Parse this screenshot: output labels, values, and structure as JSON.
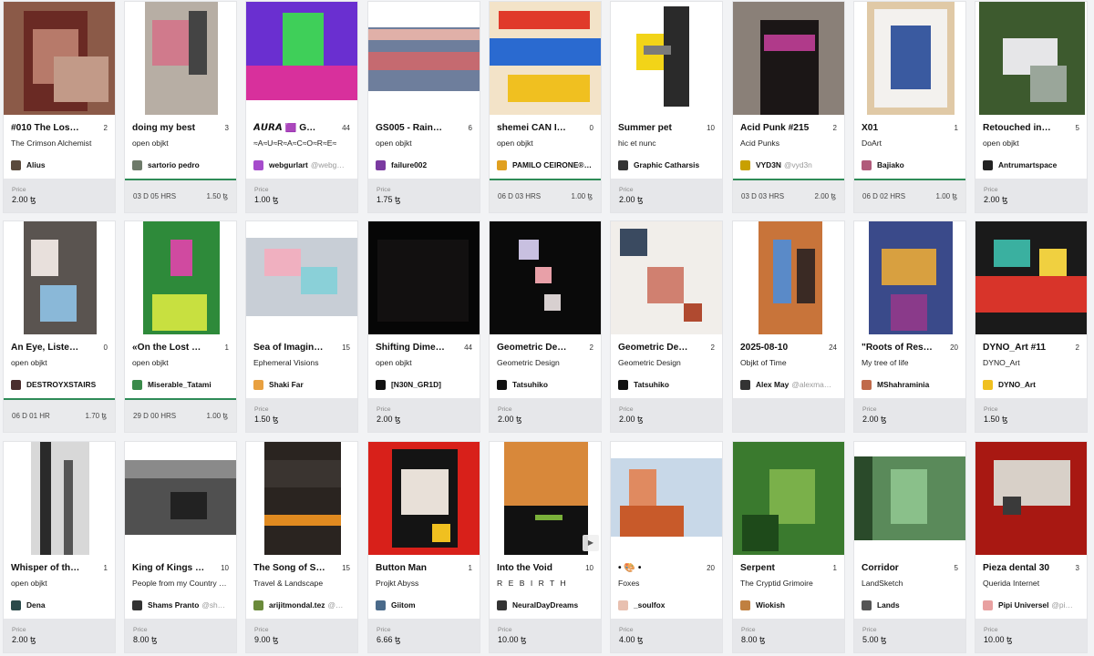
{
  "currency_symbol": "ꜩ",
  "price_label": "Price",
  "cards": [
    {
      "title": "#010 The Los…",
      "editions": "2",
      "collection": "The Crimson Alchemist",
      "artist": "Alius",
      "handle": "",
      "price": "2.00",
      "auction": false,
      "avatar_color": "#5a4a3c",
      "thumb_bg": "#8b5a48",
      "art": [
        {
          "c": "#6a2a24",
          "l": 22,
          "t": 10,
          "w": 70,
          "h": 110
        },
        {
          "c": "#b77a6a",
          "l": 32,
          "t": 30,
          "w": 50,
          "h": 60
        },
        {
          "c": "#c29a88",
          "l": 55,
          "t": 60,
          "w": 60,
          "h": 50
        }
      ]
    },
    {
      "title": "doing my best",
      "editions": "3",
      "collection": "open objkt",
      "artist": "sartorio pedro",
      "handle": "",
      "auction": true,
      "time": "03 D  05 HRS",
      "auc_price": "1.50",
      "avatar_color": "#6e7a6a",
      "thumb_bg": "#ffffff",
      "art": [
        {
          "c": "#b7aea4",
          "l": 22,
          "t": 0,
          "w": 80,
          "h": 124
        },
        {
          "c": "#d07a8c",
          "l": 30,
          "t": 20,
          "w": 40,
          "h": 50
        },
        {
          "c": "#444444",
          "l": 70,
          "t": 10,
          "w": 20,
          "h": 70
        }
      ]
    },
    {
      "title": "𝘼𝙐𝙍𝘼 🟪 G…",
      "editions": "44",
      "collection": "≈A≈U≈R≈A≈C≈O≈R≈E≈",
      "artist": "webgurlart",
      "handle": "@webg…",
      "price": "1.00",
      "auction": false,
      "avatar_color": "#a64ccc",
      "thumb_bg": "#ffffff",
      "art": [
        {
          "c": "#6a2fd0",
          "l": 0,
          "t": 0,
          "w": 124,
          "h": 108
        },
        {
          "c": "#3fcf59",
          "l": 40,
          "t": 12,
          "w": 45,
          "h": 70
        },
        {
          "c": "#d8309c",
          "l": 0,
          "t": 70,
          "w": 124,
          "h": 38
        }
      ]
    },
    {
      "title": "GS005 - Rain…",
      "editions": "6",
      "collection": "open objkt",
      "artist": "failure002",
      "handle": "",
      "price": "1.75",
      "auction": false,
      "avatar_color": "#7a3aa0",
      "thumb_bg": "#ffffff",
      "art": [
        {
          "c": "#6e7e9c",
          "l": 0,
          "t": 28,
          "w": 124,
          "h": 70
        },
        {
          "c": "#c56a70",
          "l": 0,
          "t": 55,
          "w": 124,
          "h": 20
        },
        {
          "c": "#e0b0a8",
          "l": 0,
          "t": 30,
          "w": 124,
          "h": 12
        }
      ]
    },
    {
      "title": "shemei CAN I…",
      "editions": "0",
      "collection": "open objkt",
      "artist": "PAMILO CEIRONE®…",
      "handle": "",
      "auction": true,
      "time": "06 D  03 HRS",
      "auc_price": "1.00",
      "avatar_color": "#e0a020",
      "thumb_bg": "#f3e3c8",
      "art": [
        {
          "c": "#e03a2a",
          "l": 10,
          "t": 10,
          "w": 100,
          "h": 20
        },
        {
          "c": "#2a6ad0",
          "l": 0,
          "t": 40,
          "w": 124,
          "h": 30
        },
        {
          "c": "#f0c020",
          "l": 20,
          "t": 80,
          "w": 90,
          "h": 30
        }
      ]
    },
    {
      "title": "Summer pet",
      "editions": "10",
      "collection": "hic et nunc",
      "artist": "Graphic Catharsis",
      "handle": "",
      "price": "2.00",
      "auction": false,
      "avatar_color": "#333333",
      "thumb_bg": "#ffffff",
      "art": [
        {
          "c": "#f2d418",
          "l": 28,
          "t": 35,
          "w": 40,
          "h": 40
        },
        {
          "c": "#2a2a2a",
          "l": 58,
          "t": 5,
          "w": 28,
          "h": 110
        },
        {
          "c": "#7a7a7a",
          "l": 36,
          "t": 48,
          "w": 30,
          "h": 10
        }
      ]
    },
    {
      "title": "Acid Punk #215",
      "editions": "2",
      "collection": "Acid Punks",
      "artist": "VYD3N",
      "handle": "@vyd3n",
      "auction": true,
      "time": "03 D  03 HRS",
      "auc_price": "2.00",
      "avatar_color": "#c8a000",
      "thumb_bg": "#2e2522",
      "art": [
        {
          "c": "#8a8078",
          "l": 0,
          "t": 0,
          "w": 124,
          "h": 124
        },
        {
          "c": "#1b1616",
          "l": 30,
          "t": 20,
          "w": 64,
          "h": 104
        },
        {
          "c": "#b03a8a",
          "l": 34,
          "t": 36,
          "w": 56,
          "h": 18
        }
      ]
    },
    {
      "title": "X01",
      "editions": "1",
      "collection": "DoArt",
      "artist": "Bajiako",
      "handle": "",
      "auction": true,
      "time": "06 D  02 HRS",
      "auc_price": "1.00",
      "avatar_color": "#b05a7a",
      "thumb_bg": "#ffffff",
      "art": [
        {
          "c": "#e0c9a6",
          "l": 14,
          "t": 0,
          "w": 96,
          "h": 124
        },
        {
          "c": "#f3f1ee",
          "l": 22,
          "t": 8,
          "w": 80,
          "h": 108
        },
        {
          "c": "#3a5aa0",
          "l": 40,
          "t": 26,
          "w": 44,
          "h": 70
        }
      ]
    },
    {
      "title": "Retouched in…",
      "editions": "5",
      "collection": "open objkt",
      "artist": "Antrumartspace",
      "handle": "",
      "price": "2.00",
      "auction": false,
      "avatar_color": "#222222",
      "thumb_bg": "#ffffff",
      "art": [
        {
          "c": "#3d5a2e",
          "l": 4,
          "t": 0,
          "w": 116,
          "h": 124
        },
        {
          "c": "#e6e6e8",
          "l": 30,
          "t": 40,
          "w": 60,
          "h": 40
        },
        {
          "c": "#9aa69a",
          "l": 60,
          "t": 70,
          "w": 40,
          "h": 40
        }
      ]
    },
    {
      "title": "An Eye, Liste…",
      "editions": "0",
      "collection": "open objkt",
      "artist": "DESTROYXSTAIRS",
      "handle": "",
      "auction": true,
      "time": "06 D  01 HR",
      "auc_price": "1.70",
      "avatar_color": "#4a2e2e",
      "thumb_bg": "#ffffff",
      "art": [
        {
          "c": "#5a5450",
          "l": 22,
          "t": 0,
          "w": 80,
          "h": 124
        },
        {
          "c": "#8ab8d8",
          "l": 40,
          "t": 70,
          "w": 40,
          "h": 40
        },
        {
          "c": "#e8e0dc",
          "l": 30,
          "t": 20,
          "w": 30,
          "h": 40
        }
      ]
    },
    {
      "title": "«On the Lost …",
      "editions": "1",
      "collection": "open objkt",
      "artist": "Miserable_Tatami",
      "handle": "",
      "auction": true,
      "time": "29 D  00 HRS",
      "auc_price": "1.00",
      "avatar_color": "#3a8a4a",
      "thumb_bg": "#ffffff",
      "art": [
        {
          "c": "#2e8a3a",
          "l": 20,
          "t": 0,
          "w": 84,
          "h": 124
        },
        {
          "c": "#d04aa0",
          "l": 50,
          "t": 20,
          "w": 24,
          "h": 40
        },
        {
          "c": "#c8e040",
          "l": 30,
          "t": 80,
          "w": 60,
          "h": 40
        }
      ]
    },
    {
      "title": "Sea of Imagin…",
      "editions": "15",
      "collection": "Ephemeral Visions",
      "artist": "Shaki Far",
      "handle": "",
      "price": "1.50",
      "auction": false,
      "avatar_color": "#e8a040",
      "thumb_bg": "#ffffff",
      "art": [
        {
          "c": "#c8ced6",
          "l": 0,
          "t": 18,
          "w": 124,
          "h": 86
        },
        {
          "c": "#f0b0c0",
          "l": 20,
          "t": 30,
          "w": 40,
          "h": 30
        },
        {
          "c": "#8ad0d8",
          "l": 60,
          "t": 50,
          "w": 40,
          "h": 30
        }
      ]
    },
    {
      "title": "Shifting Dime…",
      "editions": "44",
      "collection": "open objkt",
      "artist": "[N30N_GR1D]",
      "handle": "",
      "price": "2.00",
      "auction": false,
      "avatar_color": "#111111",
      "thumb_bg": "#060606",
      "art": [
        {
          "c": "#121010",
          "l": 10,
          "t": 20,
          "w": 100,
          "h": 90
        }
      ]
    },
    {
      "title": "Geometric De…",
      "editions": "2",
      "collection": "Geometric Design",
      "artist": "Tatsuhiko",
      "handle": "",
      "price": "2.00",
      "auction": false,
      "avatar_color": "#111111",
      "thumb_bg": "#0a0a0a",
      "art": [
        {
          "c": "#c8c0e0",
          "l": 32,
          "t": 20,
          "w": 22,
          "h": 22
        },
        {
          "c": "#e8a0a8",
          "l": 50,
          "t": 50,
          "w": 18,
          "h": 18
        },
        {
          "c": "#d8d0d0",
          "l": 60,
          "t": 80,
          "w": 18,
          "h": 18
        }
      ]
    },
    {
      "title": "Geometric De…",
      "editions": "2",
      "collection": "Geometric Design",
      "artist": "Tatsuhiko",
      "handle": "",
      "price": "2.00",
      "auction": false,
      "avatar_color": "#111111",
      "thumb_bg": "#f1eeea",
      "art": [
        {
          "c": "#3a4a60",
          "l": 10,
          "t": 8,
          "w": 30,
          "h": 30
        },
        {
          "c": "#d08070",
          "l": 40,
          "t": 50,
          "w": 40,
          "h": 40
        },
        {
          "c": "#b04a30",
          "l": 80,
          "t": 90,
          "w": 20,
          "h": 20
        }
      ]
    },
    {
      "title": "2025-08-10",
      "editions": "24",
      "collection": "Objkt of Time",
      "artist": "Alex May",
      "handle": "@alexma…",
      "price": "",
      "auction": false,
      "avatar_color": "#333333",
      "thumb_bg": "#ffffff",
      "art": [
        {
          "c": "#c8743a",
          "l": 28,
          "t": 0,
          "w": 70,
          "h": 124
        },
        {
          "c": "#5a8ac8",
          "l": 44,
          "t": 20,
          "w": 20,
          "h": 70
        },
        {
          "c": "#3a2a24",
          "l": 70,
          "t": 30,
          "w": 20,
          "h": 60
        }
      ]
    },
    {
      "title": "\"Roots of Res…",
      "editions": "20",
      "collection": "My tree of life",
      "artist": "MShahraminia",
      "handle": "",
      "price": "2.00",
      "auction": false,
      "avatar_color": "#c06a4a",
      "thumb_bg": "#ffffff",
      "art": [
        {
          "c": "#3a4a8a",
          "l": 16,
          "t": 0,
          "w": 92,
          "h": 124
        },
        {
          "c": "#d8a040",
          "l": 30,
          "t": 30,
          "w": 60,
          "h": 40
        },
        {
          "c": "#8a3a8a",
          "l": 40,
          "t": 80,
          "w": 40,
          "h": 40
        }
      ]
    },
    {
      "title": "DYNO_Art #11",
      "editions": "2",
      "collection": "DYNO_Art",
      "artist": "DYNO_Art",
      "handle": "",
      "price": "1.50",
      "auction": false,
      "avatar_color": "#f0c020",
      "thumb_bg": "#1a1a1a",
      "art": [
        {
          "c": "#d8342a",
          "l": 0,
          "t": 60,
          "w": 124,
          "h": 40
        },
        {
          "c": "#3ab0a0",
          "l": 20,
          "t": 20,
          "w": 40,
          "h": 30
        },
        {
          "c": "#f0d040",
          "l": 70,
          "t": 30,
          "w": 30,
          "h": 30
        }
      ]
    },
    {
      "title": "Whisper of th…",
      "editions": "1",
      "collection": "open objkt",
      "artist": "Dena",
      "handle": "",
      "price": "2.00",
      "auction": false,
      "avatar_color": "#2a4a4a",
      "thumb_bg": "#ffffff",
      "art": [
        {
          "c": "#d8d8d8",
          "l": 30,
          "t": 0,
          "w": 64,
          "h": 124
        },
        {
          "c": "#2a2a2a",
          "l": 40,
          "t": 0,
          "w": 12,
          "h": 124
        },
        {
          "c": "#555555",
          "l": 66,
          "t": 20,
          "w": 10,
          "h": 104
        }
      ]
    },
    {
      "title": "King of Kings …",
      "editions": "10",
      "collection": "People from my Country …",
      "artist": "Shams Pranto",
      "handle": "@sh…",
      "price": "8.00",
      "auction": false,
      "avatar_color": "#333333",
      "thumb_bg": "#ffffff",
      "art": [
        {
          "c": "#505050",
          "l": 0,
          "t": 20,
          "w": 124,
          "h": 82
        },
        {
          "c": "#222222",
          "l": 50,
          "t": 55,
          "w": 40,
          "h": 30
        },
        {
          "c": "#8a8a8a",
          "l": 0,
          "t": 20,
          "w": 124,
          "h": 20
        }
      ]
    },
    {
      "title": "The Song of S…",
      "editions": "15",
      "collection": "Travel & Landscape",
      "artist": "arijitmondal.tez",
      "handle": "@…",
      "price": "9.00",
      "auction": false,
      "avatar_color": "#6a8a3a",
      "thumb_bg": "#ffffff",
      "art": [
        {
          "c": "#2a2420",
          "l": 20,
          "t": 0,
          "w": 84,
          "h": 124
        },
        {
          "c": "#e08a20",
          "l": 20,
          "t": 80,
          "w": 84,
          "h": 12
        },
        {
          "c": "#3a3430",
          "l": 20,
          "t": 20,
          "w": 84,
          "h": 30
        }
      ]
    },
    {
      "title": "Button Man",
      "editions": "1",
      "collection": "Projkt Abyss",
      "artist": "Giitom",
      "handle": "",
      "price": "6.66",
      "auction": false,
      "avatar_color": "#4a6a8a",
      "thumb_bg": "#d8201a",
      "art": [
        {
          "c": "#141414",
          "l": 26,
          "t": 8,
          "w": 72,
          "h": 108
        },
        {
          "c": "#e8e0d8",
          "l": 36,
          "t": 30,
          "w": 52,
          "h": 50
        },
        {
          "c": "#f0c020",
          "l": 70,
          "t": 90,
          "w": 20,
          "h": 20
        }
      ]
    },
    {
      "title": "Into the Void",
      "editions": "10",
      "collection": "R E B I R T H",
      "artist": "NeuralDayDreams",
      "handle": "",
      "price": "10.00",
      "auction": false,
      "spaced": true,
      "avatar_color": "#333333",
      "thumb_bg": "#ffffff",
      "art": [
        {
          "c": "#d8883a",
          "l": 16,
          "t": 0,
          "w": 92,
          "h": 124
        },
        {
          "c": "#111111",
          "l": 16,
          "t": 70,
          "w": 92,
          "h": 54
        },
        {
          "c": "#7ab03a",
          "l": 50,
          "t": 80,
          "w": 30,
          "h": 6
        }
      ]
    },
    {
      "title": "• 🎨 •",
      "editions": "20",
      "collection": "Foxes",
      "artist": "_soulfox",
      "handle": "",
      "price": "4.00",
      "auction": false,
      "avatar_color": "#e8c0b0",
      "thumb_bg": "#ffffff",
      "art": [
        {
          "c": "#c8d8e8",
          "l": 0,
          "t": 18,
          "w": 124,
          "h": 86
        },
        {
          "c": "#c85a2a",
          "l": 10,
          "t": 70,
          "w": 70,
          "h": 34
        },
        {
          "c": "#e08a60",
          "l": 20,
          "t": 30,
          "w": 30,
          "h": 40
        }
      ]
    },
    {
      "title": "Serpent",
      "editions": "1",
      "collection": "The Cryptid Grimoire",
      "artist": "Wiokish",
      "handle": "",
      "price": "8.00",
      "auction": false,
      "avatar_color": "#c08040",
      "thumb_bg": "#2e5a24",
      "art": [
        {
          "c": "#3a7a2e",
          "l": 0,
          "t": 0,
          "w": 124,
          "h": 124
        },
        {
          "c": "#7ab04a",
          "l": 40,
          "t": 30,
          "w": 50,
          "h": 60
        },
        {
          "c": "#1e4a1a",
          "l": 10,
          "t": 80,
          "w": 40,
          "h": 40
        }
      ]
    },
    {
      "title": "Corridor",
      "editions": "5",
      "collection": "LandSketch",
      "artist": "Lands",
      "handle": "",
      "price": "5.00",
      "auction": false,
      "avatar_color": "#555555",
      "thumb_bg": "#ffffff",
      "art": [
        {
          "c": "#5a8a5a",
          "l": 0,
          "t": 16,
          "w": 124,
          "h": 92
        },
        {
          "c": "#8ac08a",
          "l": 40,
          "t": 30,
          "w": 40,
          "h": 60
        },
        {
          "c": "#2a4a2a",
          "l": 0,
          "t": 16,
          "w": 20,
          "h": 92
        }
      ]
    },
    {
      "title": "Pieza dental 30",
      "editions": "3",
      "collection": "Querida Internet",
      "artist": "Pipi Universel",
      "handle": "@pi…",
      "price": "10.00",
      "auction": false,
      "avatar_color": "#e8a0a0",
      "thumb_bg": "#c8201a",
      "art": [
        {
          "c": "#a81812",
          "l": 0,
          "t": 0,
          "w": 124,
          "h": 124
        },
        {
          "c": "#d8d0c8",
          "l": 20,
          "t": 20,
          "w": 84,
          "h": 50
        },
        {
          "c": "#3a3a3a",
          "l": 30,
          "t": 60,
          "w": 20,
          "h": 20
        }
      ]
    }
  ]
}
